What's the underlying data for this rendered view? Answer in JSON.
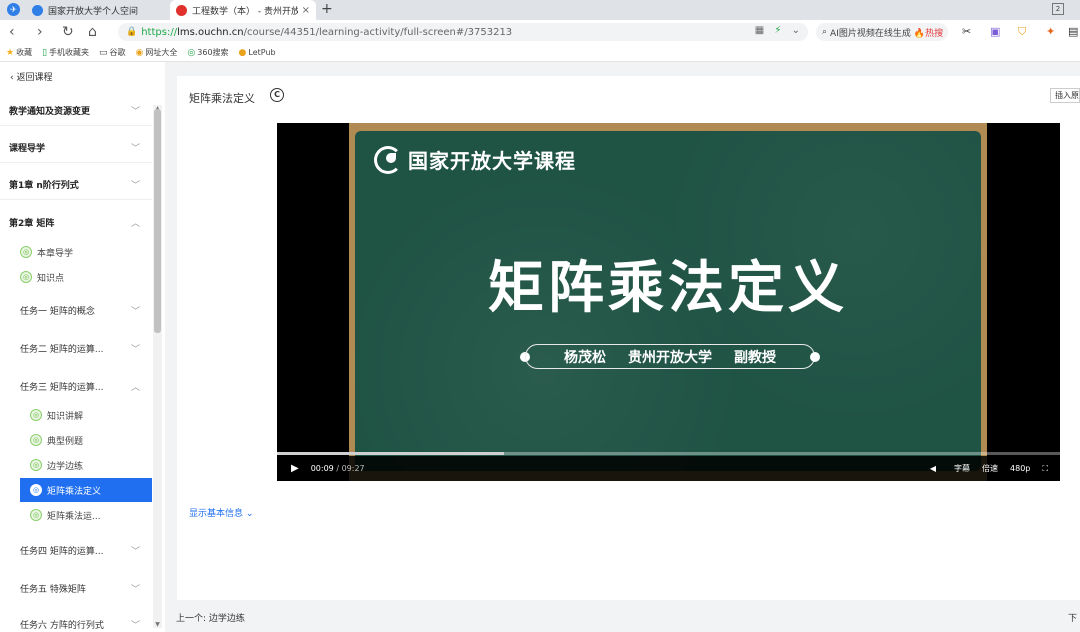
{
  "browser": {
    "tabs": [
      {
        "title": "国家开放大学个人空间",
        "favicon_color": "#2f7fe6"
      },
      {
        "title": "工程数学（本） - 贵州开放大学",
        "favicon_color": "#e0312d"
      }
    ],
    "new_tab_label": "+",
    "window_control_label": "2",
    "address": {
      "scheme": "https://",
      "host": "lms.ouchn.cn",
      "path": "/course/44351/learning-activity/full-screen#/3753213"
    },
    "ai_search": {
      "text": "AI图片视频在线生成",
      "hot_label": "🔥热搜"
    },
    "bookmarks": [
      "收藏",
      "手机收藏夹",
      "谷歌",
      "网址大全",
      "360搜索",
      "LetPub"
    ]
  },
  "sidebar": {
    "back_label": "返回课程",
    "sections": [
      {
        "label": "教学通知及资源变更",
        "expanded": false
      },
      {
        "label": "课程导学",
        "expanded": false
      },
      {
        "label": "第1章 n阶行列式",
        "expanded": false
      },
      {
        "label": "第2章 矩阵",
        "expanded": true
      }
    ],
    "chapter2_items": [
      {
        "label": "本章导学"
      },
      {
        "label": "知识点"
      }
    ],
    "tasks": [
      {
        "label": "任务一 矩阵的概念",
        "expanded": false
      },
      {
        "label": "任务二 矩阵的运算...",
        "expanded": false
      },
      {
        "label": "任务三 矩阵的运算...",
        "expanded": true
      }
    ],
    "task3_items": [
      {
        "label": "知识讲解",
        "active": false
      },
      {
        "label": "典型例题",
        "active": false
      },
      {
        "label": "边学边练",
        "active": false
      },
      {
        "label": "矩阵乘法定义",
        "active": true
      },
      {
        "label": "矩阵乘法运...",
        "active": false
      }
    ],
    "more_tasks": [
      {
        "label": "任务四 矩阵的运算...",
        "expanded": false
      },
      {
        "label": "任务五 特殊矩阵",
        "expanded": false
      },
      {
        "label": "任务六 方阵的行列式",
        "expanded": false
      }
    ]
  },
  "main": {
    "title": "矩阵乘法定义",
    "cc_label": "C",
    "insert_label": "插入原",
    "show_info_label": "显示基本信息",
    "video": {
      "logo_text": "国家开放大学课程",
      "slide_title": "矩阵乘法定义",
      "author": [
        "杨茂松",
        "贵州开放大学",
        "副教授"
      ],
      "current_time": "00:09",
      "total_time": "09:27",
      "progress_fraction": 0.29,
      "subtitle_label": "字幕",
      "speed_label": "倍速",
      "quality_label": "480p"
    }
  },
  "footer": {
    "prev_label": "上一个: 边学边练",
    "next_label": "下"
  }
}
